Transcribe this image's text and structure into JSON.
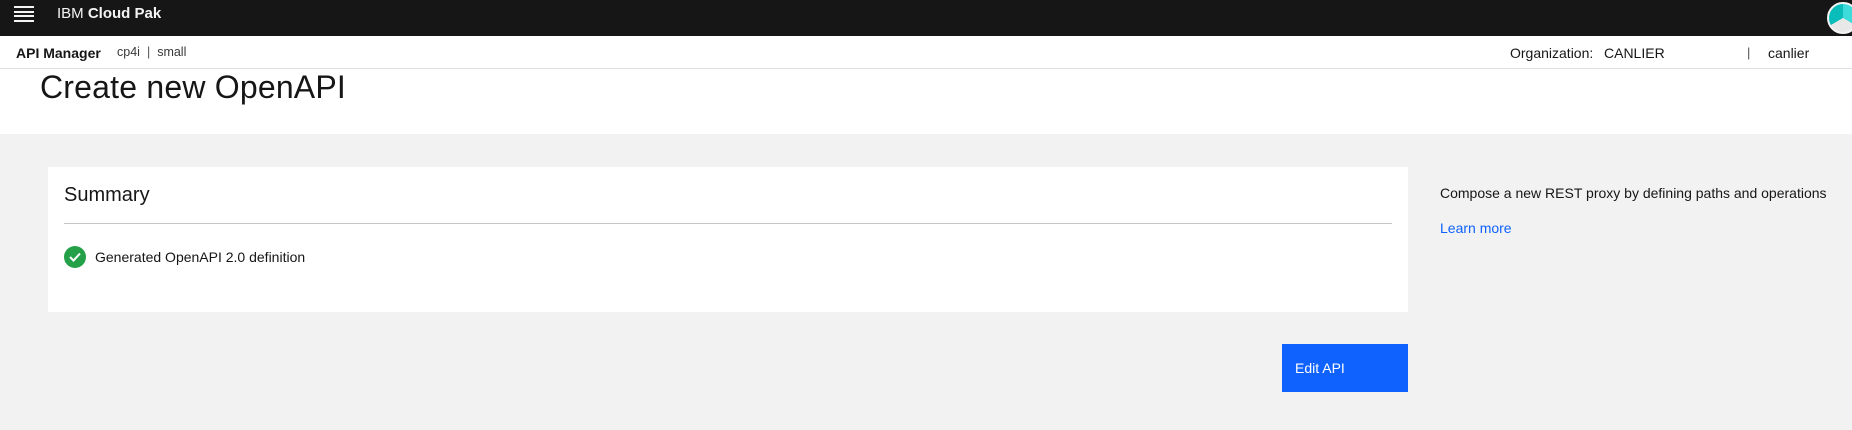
{
  "masthead": {
    "brand_prefix": "IBM",
    "brand_product": "Cloud Pak"
  },
  "subheader": {
    "app_name": "API Manager",
    "context_instance": "cp4i",
    "context_separator": "|",
    "context_size": "small",
    "org_label": "Organization:",
    "org_value": "CANLIER",
    "user_separator": "|",
    "user_name": "canlier"
  },
  "page": {
    "title": "Create new OpenAPI"
  },
  "summary": {
    "heading": "Summary",
    "status_text": "Generated OpenAPI 2.0 definition"
  },
  "side": {
    "description": "Compose a new REST proxy by defining paths and operations",
    "learn_more": "Learn more"
  },
  "actions": {
    "edit_api": "Edit API"
  },
  "colors": {
    "masthead_bg": "#161616",
    "primary_blue": "#0f62fe",
    "success_green": "#24a148",
    "page_bg": "#f2f2f2"
  },
  "icons": {
    "menu": "hamburger-menu-icon",
    "status": "checkmark-filled-icon",
    "avatar": "user-avatar"
  }
}
